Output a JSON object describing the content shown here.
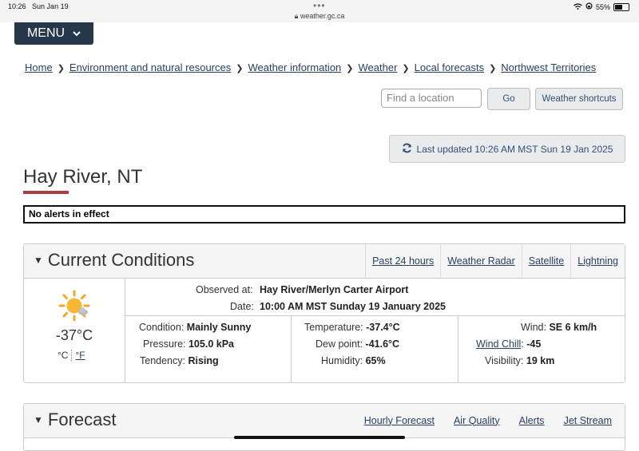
{
  "status_bar": {
    "time": "10:26",
    "date": "Sun Jan 19",
    "url": "weather.gc.ca",
    "battery": "55%"
  },
  "menu": {
    "label": "MENU"
  },
  "breadcrumb": [
    "Home",
    "Environment and natural resources",
    "Weather information",
    "Weather",
    "Local forecasts",
    "Northwest Territories"
  ],
  "search": {
    "placeholder": "Find a location",
    "go_label": "Go",
    "shortcuts_label": "Weather shortcuts"
  },
  "last_updated": "Last updated  10:26 AM MST Sun 19 Jan 2025",
  "page_title": "Hay River, NT",
  "alerts_text": "No alerts in effect",
  "current": {
    "title": "Current Conditions",
    "links": [
      "Past 24 hours",
      "Weather Radar",
      "Satellite",
      "Lightning"
    ],
    "temp_display": "-37°C",
    "unit_c": "°C",
    "unit_f": "°F",
    "observed_label": "Observed at:",
    "observed_value": "Hay River/Merlyn Carter Airport",
    "date_label": "Date:",
    "date_value": "10:00 AM MST Sunday 19 January 2025",
    "condition_label": "Condition:",
    "condition_value": "Mainly Sunny",
    "pressure_label": "Pressure:",
    "pressure_value": "105.0 kPa",
    "tendency_label": "Tendency:",
    "tendency_value": "Rising",
    "temperature_label": "Temperature:",
    "temperature_value": "-37.4°C",
    "dewpoint_label": "Dew point:",
    "dewpoint_value": "-41.6°C",
    "humidity_label": "Humidity:",
    "humidity_value": "65%",
    "wind_label": "Wind:",
    "wind_value": "SE 6 km/h",
    "windchill_label": "Wind Chill",
    "windchill_value": "-45",
    "visibility_label": "Visibility:",
    "visibility_value": "19 km"
  },
  "forecast": {
    "title": "Forecast",
    "links": [
      "Hourly Forecast",
      "Air Quality",
      "Alerts",
      "Jet Stream"
    ]
  }
}
